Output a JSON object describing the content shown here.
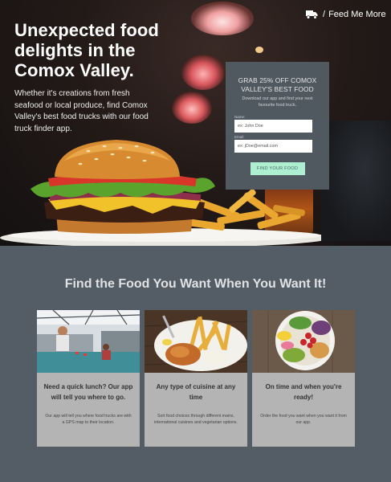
{
  "nav": {
    "separator": "/",
    "label": "Feed Me More",
    "icon": "truck-icon"
  },
  "hero": {
    "title": "Unexpected food delights in the Comox Valley.",
    "text": "Whether it's creations from fresh seafood or local produce, find Comox Valley's best food trucks with our food truck finder app."
  },
  "promo": {
    "title": "GRAB 25% OFF COMOX VALLEY'S BEST FOOD",
    "subtitle": "Download our app and find your next favourite food truck.",
    "name_label": "Name:",
    "name_placeholder": "ex: John Doe",
    "email_label": "Email:",
    "email_placeholder": "ex: jDoe@email.com",
    "button": "FIND YOUR FOOD"
  },
  "section": {
    "title": "Find the Food You Want When You Want It!",
    "cards": [
      {
        "title": "Need a quick lunch? Our app will tell you where to go.",
        "text": "Our app will tell you where food trucks are with a GPS map to their location."
      },
      {
        "title": "Any type of cuisine at any time",
        "text": "Sort food choices through different mains, international cuisines and vegetarian options."
      },
      {
        "title": "On time and when you're ready!",
        "text": "Order the food you want when you want it from our app."
      }
    ]
  },
  "colors": {
    "accent": "#aeeed1",
    "panel": "#505860",
    "page": "#545c66",
    "card": "#b4b4b4"
  }
}
